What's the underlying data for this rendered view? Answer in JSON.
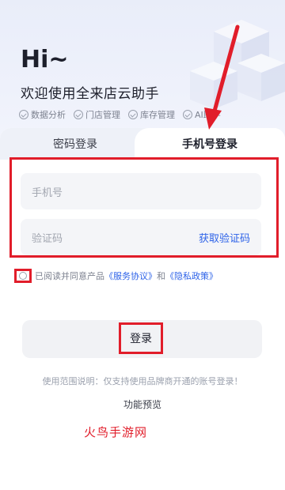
{
  "header": {
    "greeting": "Hi~",
    "welcome": "欢迎使用全来店云助手",
    "features": [
      "数据分析",
      "门店管理",
      "库存管理",
      "AI助手"
    ]
  },
  "tabs": [
    {
      "label": "密码登录",
      "active": false
    },
    {
      "label": "手机号登录",
      "active": true
    }
  ],
  "form": {
    "phone_placeholder": "手机号",
    "code_placeholder": "验证码",
    "get_code_label": "获取验证码"
  },
  "agreement": {
    "prefix": "已阅读并同意产品",
    "service": "《服务协议》",
    "and": "和",
    "privacy": "《隐私政策》"
  },
  "login_label": "登录",
  "scope_note": "使用范围说明：仅支持使用品牌商开通的账号登录！",
  "preview_label": "功能预览",
  "watermark": "火鸟手游网",
  "colors": {
    "annotation": "#e11d2a",
    "link": "#2e63e8",
    "hero": "#e9edf9"
  }
}
